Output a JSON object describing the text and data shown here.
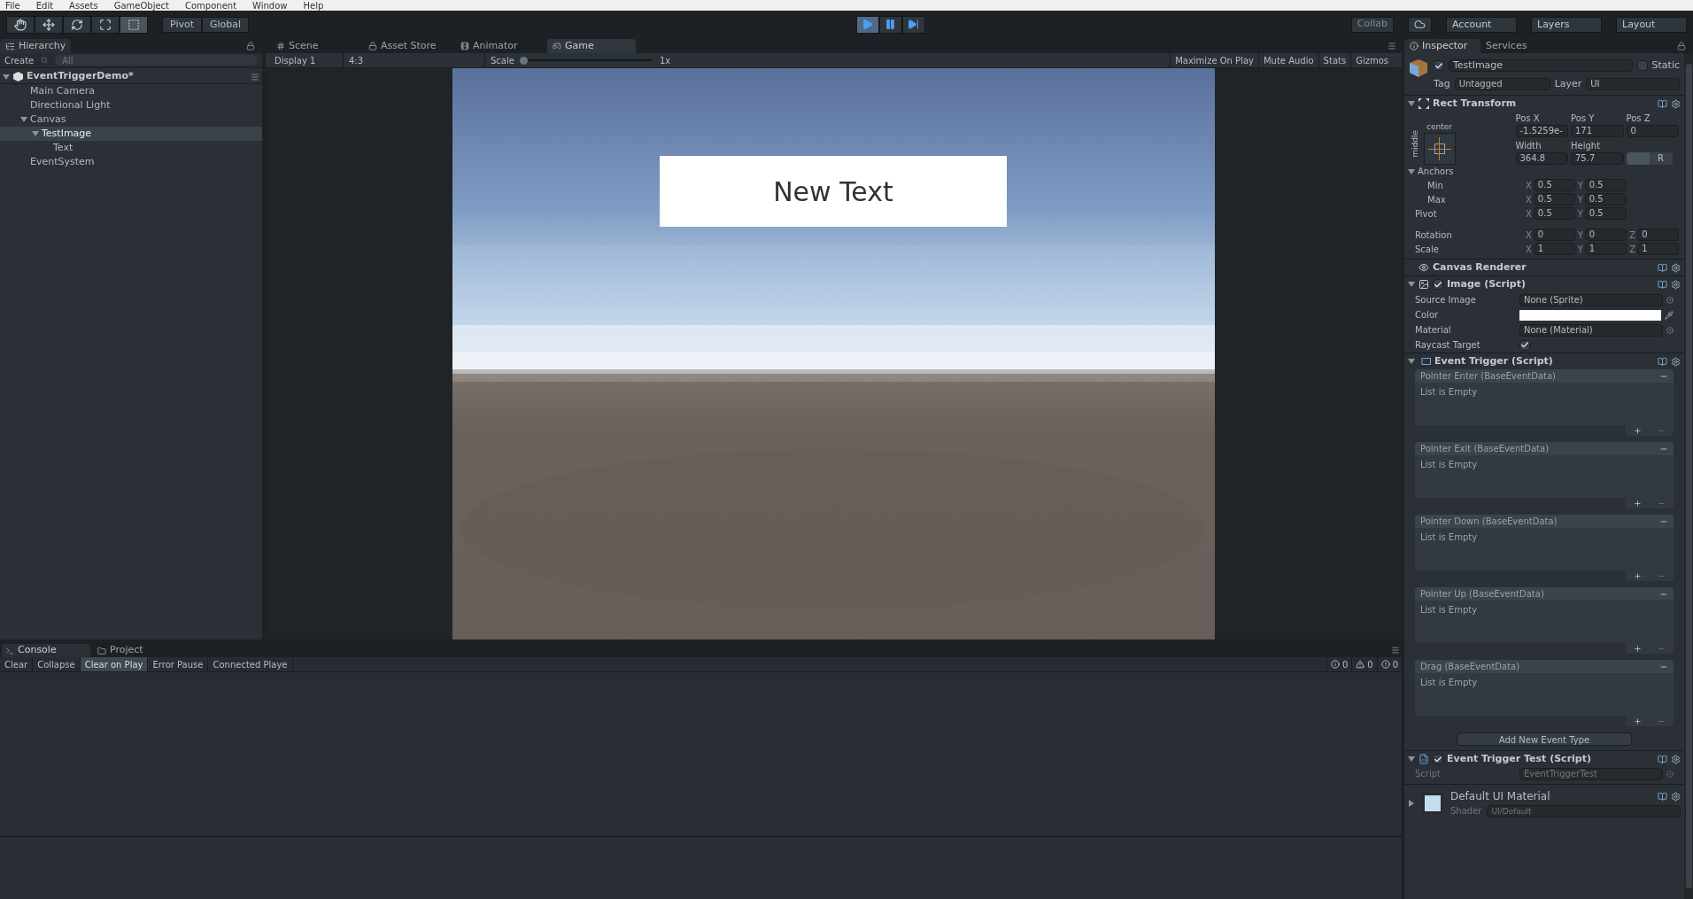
{
  "menu": [
    "File",
    "Edit",
    "Assets",
    "GameObject",
    "Component",
    "Window",
    "Help"
  ],
  "toolbar": {
    "tools": [
      {
        "kind": "hand",
        "selected": false
      },
      {
        "kind": "move",
        "selected": false
      },
      {
        "kind": "rotate",
        "selected": false
      },
      {
        "kind": "scale",
        "selected": false
      },
      {
        "kind": "rect",
        "selected": true
      }
    ],
    "pivot": "Pivot",
    "global": "Global",
    "play": [
      {
        "kind": "play",
        "selected": true
      },
      {
        "kind": "pause",
        "selected": false
      },
      {
        "kind": "step",
        "selected": false
      }
    ],
    "collab": "Collab",
    "account": "Account",
    "layers": "Layers",
    "layout": "Layout"
  },
  "hierarchy": {
    "tab": "Hierarchy",
    "create": "Create",
    "placeholder": "All",
    "scene": {
      "label": "EventTriggerDemo*",
      "expanded": true,
      "children": [
        {
          "label": "Main Camera",
          "selected": false
        },
        {
          "label": "Directional Light",
          "selected": false
        },
        {
          "label": "Canvas",
          "selected": false,
          "expanded": true,
          "children": [
            {
              "label": "TestImage",
              "selected": true,
              "expanded": true,
              "children": [
                {
                  "label": "Text",
                  "selected": false
                }
              ]
            }
          ]
        },
        {
          "label": "EventSystem",
          "selected": false
        }
      ]
    }
  },
  "center_tabs": [
    {
      "kind": "scene",
      "label": "Scene",
      "selected": false
    },
    {
      "kind": "store",
      "label": "Asset Store",
      "selected": false
    },
    {
      "kind": "animator",
      "label": "Animator",
      "selected": false
    },
    {
      "kind": "game",
      "label": "Game",
      "selected": true
    }
  ],
  "game_toolbar": {
    "display": "Display 1",
    "aspect": "4:3",
    "scale_label": "Scale",
    "scale": {
      "level": 0
    },
    "scale_value": "1x",
    "buttons": [
      {
        "label": "Maximize On Play",
        "on": false
      },
      {
        "label": "Mute Audio",
        "on": false
      },
      {
        "label": "Stats",
        "on": false
      }
    ],
    "gizmos": "Gizmos"
  },
  "game_view": {
    "overlay_text": "New Text"
  },
  "console": {
    "tabs": [
      {
        "kind": "console",
        "label": "Console",
        "selected": true
      },
      {
        "kind": "project",
        "label": "Project",
        "selected": false
      }
    ],
    "buttons": [
      {
        "label": "Clear",
        "on": false
      },
      {
        "label": "Collapse",
        "on": false
      },
      {
        "label": "Clear on Play",
        "on": true
      },
      {
        "label": "Error Pause",
        "on": false
      }
    ],
    "player_dropdown": "Connected Playe",
    "counts": [
      {
        "kind": "info",
        "count": "0"
      },
      {
        "kind": "warning",
        "count": "0"
      },
      {
        "kind": "error",
        "count": "0"
      }
    ]
  },
  "inspector": {
    "tabs": [
      {
        "label": "Inspector",
        "selected": true
      },
      {
        "label": "Services",
        "selected": false
      }
    ],
    "object": {
      "active": true,
      "name": "TestImage",
      "static_label": "Static",
      "static": false,
      "tag_label": "Tag",
      "tag": "Untagged",
      "layer_label": "Layer",
      "layer": "UI"
    },
    "rect_transform": {
      "title": "Rect Transform",
      "expanded": true,
      "anchor_h": "center",
      "anchor_v": "middle",
      "pos_fields": [
        {
          "label": "Pos X",
          "value": "-1.5259e-"
        },
        {
          "label": "Pos Y",
          "value": "171"
        },
        {
          "label": "Pos Z",
          "value": "0"
        }
      ],
      "size_fields": [
        {
          "label": "Width",
          "value": "364.8"
        },
        {
          "label": "Height",
          "value": "75.7"
        }
      ],
      "raw_button": "R",
      "anchors": {
        "label": "Anchors",
        "expanded": true,
        "rows": [
          {
            "label": "Min",
            "values": [
              {
                "axis": "X",
                "value": "0.5"
              },
              {
                "axis": "Y",
                "value": "0.5"
              }
            ]
          },
          {
            "label": "Max",
            "values": [
              {
                "axis": "X",
                "value": "0.5"
              },
              {
                "axis": "Y",
                "value": "0.5"
              }
            ]
          }
        ]
      },
      "rows": [
        {
          "label": "Pivot",
          "values": [
            {
              "axis": "X",
              "value": "0.5"
            },
            {
              "axis": "Y",
              "value": "0.5"
            }
          ]
        },
        {
          "label": "Rotation",
          "values": [
            {
              "axis": "X",
              "value": "0"
            },
            {
              "axis": "Y",
              "value": "0"
            },
            {
              "axis": "Z",
              "value": "0"
            }
          ]
        },
        {
          "label": "Scale",
          "values": [
            {
              "axis": "X",
              "value": "1"
            },
            {
              "axis": "Y",
              "value": "1"
            },
            {
              "axis": "Z",
              "value": "1"
            }
          ]
        }
      ]
    },
    "canvas_renderer": {
      "title": "Canvas Renderer"
    },
    "image": {
      "title": "Image (Script)",
      "expanded": true,
      "enabled": true,
      "fields": [
        {
          "kind": "object",
          "label": "Source Image",
          "value": "None (Sprite)"
        },
        {
          "kind": "color",
          "label": "Color",
          "color": "#ffffff"
        },
        {
          "kind": "object",
          "label": "Material",
          "value": "None (Material)"
        },
        {
          "kind": "toggle",
          "label": "Raycast Target",
          "checked": true
        }
      ]
    },
    "event_trigger": {
      "title": "Event Trigger (Script)",
      "expanded": true,
      "events": [
        {
          "title": "Pointer Enter (BaseEventData)",
          "body": "List is Empty"
        },
        {
          "title": "Pointer Exit (BaseEventData)",
          "body": "List is Empty"
        },
        {
          "title": "Pointer Down (BaseEventData)",
          "body": "List is Empty"
        },
        {
          "title": "Pointer Up (BaseEventData)",
          "body": "List is Empty"
        },
        {
          "title": "Drag (BaseEventData)",
          "body": "List is Empty"
        }
      ],
      "add_button": "Add New Event Type"
    },
    "event_test": {
      "title": "Event Trigger Test (Script)",
      "expanded": true,
      "enabled": true,
      "script_label": "Script",
      "script": "EventTriggerTest"
    },
    "material": {
      "name": "Default UI Material",
      "expanded": false,
      "shader_label": "Shader",
      "shader": "UI/Default"
    }
  }
}
